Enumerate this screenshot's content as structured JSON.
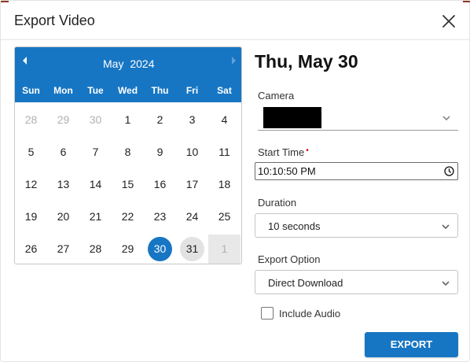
{
  "dialog": {
    "title": "Export Video"
  },
  "calendar": {
    "month": "May",
    "year": "2024",
    "weekdays": [
      "Sun",
      "Mon",
      "Tue",
      "Wed",
      "Thu",
      "Fri",
      "Sat"
    ],
    "weeks": [
      [
        "28",
        "29",
        "30",
        "1",
        "2",
        "3",
        "4"
      ],
      [
        "5",
        "6",
        "7",
        "8",
        "9",
        "10",
        "11"
      ],
      [
        "12",
        "13",
        "14",
        "15",
        "16",
        "17",
        "18"
      ],
      [
        "19",
        "20",
        "21",
        "22",
        "23",
        "24",
        "25"
      ],
      [
        "26",
        "27",
        "28",
        "29",
        "30",
        "31",
        "1"
      ]
    ],
    "selected_day": "30",
    "today_day": "31"
  },
  "selected_date_heading": "Thu, May 30",
  "form": {
    "camera_label": "Camera",
    "start_time_label": "Start Time",
    "start_time_required_mark": "•",
    "start_time_value": "10:10:50 PM",
    "duration_label": "Duration",
    "duration_value": "10 seconds",
    "export_option_label": "Export Option",
    "export_option_value": "Direct Download",
    "include_audio_label": "Include Audio",
    "include_audio_checked": false
  },
  "actions": {
    "export_label": "EXPORT"
  },
  "colors": {
    "accent": "#1776c3",
    "required": "#d0021b",
    "today_bg": "#e2e2e2"
  },
  "icons": [
    "close-icon",
    "chevron-left-icon",
    "chevron-right-icon",
    "chevron-down-icon",
    "clock-icon"
  ]
}
